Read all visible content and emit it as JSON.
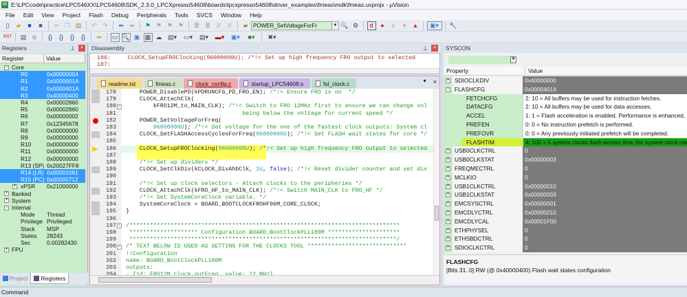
{
  "window": {
    "title": "E:\\LPCcode\\practice\\LPC546XX\\LPC54608\\SDK_2.3.0_LPCXpresso54608\\boards\\lpcxpresso54608\\driver_examples\\fmeas\\mdk\\fmeas.uvprojx - µVision"
  },
  "menu": [
    "File",
    "Edit",
    "View",
    "Project",
    "Flash",
    "Debug",
    "Peripherals",
    "Tools",
    "SVCS",
    "Window",
    "Help"
  ],
  "toolbar": {
    "find_combo_value": "POWER_SetVoltageForFr"
  },
  "registers": {
    "title": "Registers",
    "col_register": "Register",
    "col_value": "Value",
    "rows": [
      {
        "name": "Core",
        "value": "",
        "level": 0,
        "expander": "minus",
        "selected": false
      },
      {
        "name": "R0",
        "value": "0x00000004",
        "level": 1,
        "selected": true
      },
      {
        "name": "R1",
        "value": "0x0000001A",
        "level": 1,
        "selected": true
      },
      {
        "name": "R2",
        "value": "0x0000401A",
        "level": 1,
        "selected": true
      },
      {
        "name": "R3",
        "value": "0x40000400",
        "level": 1,
        "selected": true
      },
      {
        "name": "R4",
        "value": "0x00002860",
        "level": 1,
        "selected": false
      },
      {
        "name": "R5",
        "value": "0x00002860",
        "level": 1,
        "selected": false
      },
      {
        "name": "R6",
        "value": "0x00000002",
        "level": 1,
        "selected": false
      },
      {
        "name": "R7",
        "value": "0x12345678",
        "level": 1,
        "selected": false
      },
      {
        "name": "R8",
        "value": "0x00000000",
        "level": 1,
        "selected": false
      },
      {
        "name": "R9",
        "value": "0x00000000",
        "level": 1,
        "selected": false
      },
      {
        "name": "R10",
        "value": "0x00000000",
        "level": 1,
        "selected": false
      },
      {
        "name": "R11",
        "value": "0x00000000",
        "level": 1,
        "selected": false
      },
      {
        "name": "R12",
        "value": "0x00000000",
        "level": 1,
        "selected": false
      },
      {
        "name": "R13 (SP)",
        "value": "0x20027FF8",
        "level": 1,
        "selected": false
      },
      {
        "name": "R14 (LR)",
        "value": "0x00001061",
        "level": 1,
        "selected": true
      },
      {
        "name": "R15 (PC)",
        "value": "0x00000712",
        "level": 1,
        "selected": true
      },
      {
        "name": "xPSR",
        "value": "0x21000000",
        "level": 1,
        "expander": "plus",
        "selected": false
      },
      {
        "name": "Banked",
        "value": "",
        "level": 0,
        "expander": "plus",
        "selected": false
      },
      {
        "name": "System",
        "value": "",
        "level": 0,
        "expander": "plus",
        "selected": false
      },
      {
        "name": "Internal",
        "value": "",
        "level": 0,
        "expander": "minus",
        "selected": false
      },
      {
        "name": "Mode",
        "value": "Thread",
        "level": 1,
        "selected": false
      },
      {
        "name": "Privilege",
        "value": "Privileged",
        "level": 1,
        "selected": false
      },
      {
        "name": "Stack",
        "value": "MSP",
        "level": 1,
        "selected": false
      },
      {
        "name": "States",
        "value": "28243",
        "level": 1,
        "selected": false
      },
      {
        "name": "Sec",
        "value": "0.00282430",
        "level": 1,
        "selected": false
      },
      {
        "name": "FPU",
        "value": "",
        "level": 0,
        "expander": "plus",
        "selected": false
      }
    ],
    "tabs": [
      {
        "label": "Project",
        "active": false
      },
      {
        "label": "Registers",
        "active": true
      }
    ]
  },
  "disassembly": {
    "title": "Disassembly",
    "lines": [
      "186:     CLOCK_SetupFROClocking(96000000U); /*!< Set up high frequency FRO output to selected",
      "187: "
    ]
  },
  "editor": {
    "tabs": [
      {
        "label": "readme.txt",
        "color": "#f5dc8c"
      },
      {
        "label": "fmeas.c",
        "color": "#cfe3c4"
      },
      {
        "label": "clock_config.c",
        "color": "#f2a8a8",
        "active": true
      },
      {
        "label": "startup_LPC54608.s",
        "color": "#c9b8e8"
      },
      {
        "label": "fsl_clock.c",
        "color": "#b8dccb"
      }
    ],
    "current_line": 186,
    "breakpoint_line": 182,
    "lines": [
      {
        "n": "178",
        "s": [
          [
            "    POWER_DisablePD(kPDRUNCFG_PD_FRO_EN); ",
            ""
          ],
          [
            "/*!< Ensure FRO is on  */",
            "cm"
          ]
        ]
      },
      {
        "n": "179",
        "s": [
          [
            "    CLOCK_AttachClk(",
            ""
          ]
        ]
      },
      {
        "n": "180",
        "s": [
          [
            "        kFRO12M_to_MAIN_CLK); ",
            ""
          ],
          [
            "/*!< Switch to FRO 12MHz first to ensure we can change vol",
            "cm"
          ]
        ]
      },
      {
        "n": "181",
        "s": [
          [
            "                                  being below the voltage for current speed */",
            "cm"
          ]
        ]
      },
      {
        "n": "182",
        "s": [
          [
            "    POWER_SetVoltageForFreq(",
            ""
          ]
        ]
      },
      {
        "n": "183",
        "s": [
          [
            "        ",
            ""
          ],
          [
            "96000000U",
            "num"
          ],
          [
            "); ",
            ""
          ],
          [
            "/*!< Set voltage for the one of the fastest clock outputs: System cl",
            "cm"
          ]
        ]
      },
      {
        "n": "184",
        "s": [
          [
            "    CLOCK_SetFLASHAccessCyclesForFreq(",
            ""
          ],
          [
            "96000000U",
            "num"
          ],
          [
            "); ",
            ""
          ],
          [
            "/*!< Set FLASH wait states for core */",
            "cm"
          ]
        ]
      },
      {
        "n": "185",
        "s": []
      },
      {
        "n": "186",
        "s": [
          [
            "    CLOCK_SetupFROClocking(",
            ""
          ],
          [
            "96000000U",
            "num"
          ],
          [
            "); ",
            ""
          ],
          [
            "/*!< Set up high frequency FRO output to selected",
            "cm"
          ]
        ]
      },
      {
        "n": "187",
        "s": []
      },
      {
        "n": "188",
        "s": [
          [
            "    ",
            ""
          ],
          [
            "/*!< Set up dividers */",
            "cm"
          ]
        ]
      },
      {
        "n": "189",
        "s": [
          [
            "    CLOCK_SetClkDiv(kCLOCK_DivAhbClk, ",
            ""
          ],
          [
            "1U",
            "num"
          ],
          [
            ", ",
            ""
          ],
          [
            "false",
            "kw"
          ],
          [
            "); ",
            ""
          ],
          [
            "/*!< Reset divider counter and set div",
            "cm"
          ]
        ]
      },
      {
        "n": "190",
        "s": []
      },
      {
        "n": "191",
        "s": [
          [
            "    /*!< Set up clock selectors - Attach clocks to the peripheries */",
            "cm"
          ]
        ]
      },
      {
        "n": "192",
        "s": [
          [
            "    CLOCK_AttachClk(kFRO_HF_to_MAIN_CLK); ",
            ""
          ],
          [
            "/*!< Switch MAIN_CLK to FRO_HF */",
            "cm"
          ]
        ]
      },
      {
        "n": "193",
        "s": [
          [
            "    /*!< Set SystemCoreClock variable. */",
            "cm"
          ]
        ]
      },
      {
        "n": "194",
        "s": [
          [
            "    SystemCoreClock = BOARD_BOOTCLOCKFROHF96M_CORE_CLOCK;",
            ""
          ]
        ]
      },
      {
        "n": "195",
        "s": [
          [
            "}",
            ""
          ]
        ]
      },
      {
        "n": "196",
        "s": []
      },
      {
        "n": "197",
        "s": [
          [
            "/*******************************************************************************",
            "cm"
          ]
        ]
      },
      {
        "n": "198",
        "s": [
          [
            " ******************** Configuration BOARD_BootClockPLL180M *********************",
            "cm"
          ]
        ]
      },
      {
        "n": "199",
        "s": [
          [
            " ******************************************************************************/",
            "cm"
          ]
        ]
      },
      {
        "n": "200",
        "s": [
          [
            "/* TEXT BELOW IS USED AS SETTING FOR THE CLOCKS TOOL *****************************",
            "cm"
          ]
        ]
      },
      {
        "n": "201",
        "s": [
          [
            "!!Configuration",
            "cm"
          ]
        ]
      },
      {
        "n": "202",
        "s": [
          [
            "name: BOARD_BootClockPLL180M",
            "cm"
          ]
        ]
      },
      {
        "n": "203",
        "s": [
          [
            "outputs:",
            "cm"
          ]
        ]
      },
      {
        "n": "204",
        "s": [
          [
            "- {id: FRO12M_clock.outFreq, value: 12 MHz}",
            "cm"
          ]
        ]
      }
    ]
  },
  "syscon": {
    "title": "SYSCON",
    "col_property": "Property",
    "col_value": "Value",
    "rows": [
      {
        "name": "SDIOCLKDIV",
        "value": "0x40000000",
        "type": "reg"
      },
      {
        "name": "FLASHCFG",
        "value": "0x0000401A",
        "type": "reg",
        "expanded": true
      },
      {
        "name": "FETCHCFG",
        "value": "2: 10 = All buffers may be used for instruction fetches.",
        "type": "field"
      },
      {
        "name": "DATACFG",
        "value": "2: 10 = All buffers may be used for data accesses.",
        "type": "field"
      },
      {
        "name": "ACCEL",
        "value": "1: 1 = Flash acceleration is enabled. Performance is enhanced, dependent",
        "type": "field"
      },
      {
        "name": "PREFEN",
        "value": "0: 0 = No instruction prefetch is performed.",
        "type": "field"
      },
      {
        "name": "PREFOVR",
        "value": "0: 0 = Any previously initiated prefetch will be completed.",
        "type": "field"
      },
      {
        "name": "FLASHTIM",
        "value": "4: 100 = 5 system clocks flash access time (for system clock rates up to",
        "type": "field",
        "highlight": true
      },
      {
        "name": "USB0CLKCTRL",
        "value": "0",
        "type": "reg"
      },
      {
        "name": "USB0CLKSTAT",
        "value": "0x00000003",
        "type": "reg"
      },
      {
        "name": "FREQMECTRL",
        "value": "0",
        "type": "reg"
      },
      {
        "name": "MCLKIO",
        "value": "0",
        "type": "reg"
      },
      {
        "name": "USB1CLKCTRL",
        "value": "0x00000010",
        "type": "reg"
      },
      {
        "name": "USB1CLKSTAT",
        "value": "0x00000003",
        "type": "reg"
      },
      {
        "name": "EMCSYSCTRL",
        "value": "0x00000001",
        "type": "reg"
      },
      {
        "name": "EMCDLYCTRL",
        "value": "0x00000210",
        "type": "reg"
      },
      {
        "name": "EMCDLYCAL",
        "value": "0x00001F00",
        "type": "reg"
      },
      {
        "name": "ETHPHYSEL",
        "value": "0",
        "type": "reg"
      },
      {
        "name": "ETHSBDCTRL",
        "value": "0",
        "type": "reg"
      },
      {
        "name": "SDIOCLKCTRL",
        "value": "0",
        "type": "reg"
      }
    ],
    "desc_title": "FLASHCFG",
    "desc_text": "[Bits 31..0] RW (@ 0x40000400) Flash wait states configuration"
  },
  "command": {
    "title": "Command"
  }
}
